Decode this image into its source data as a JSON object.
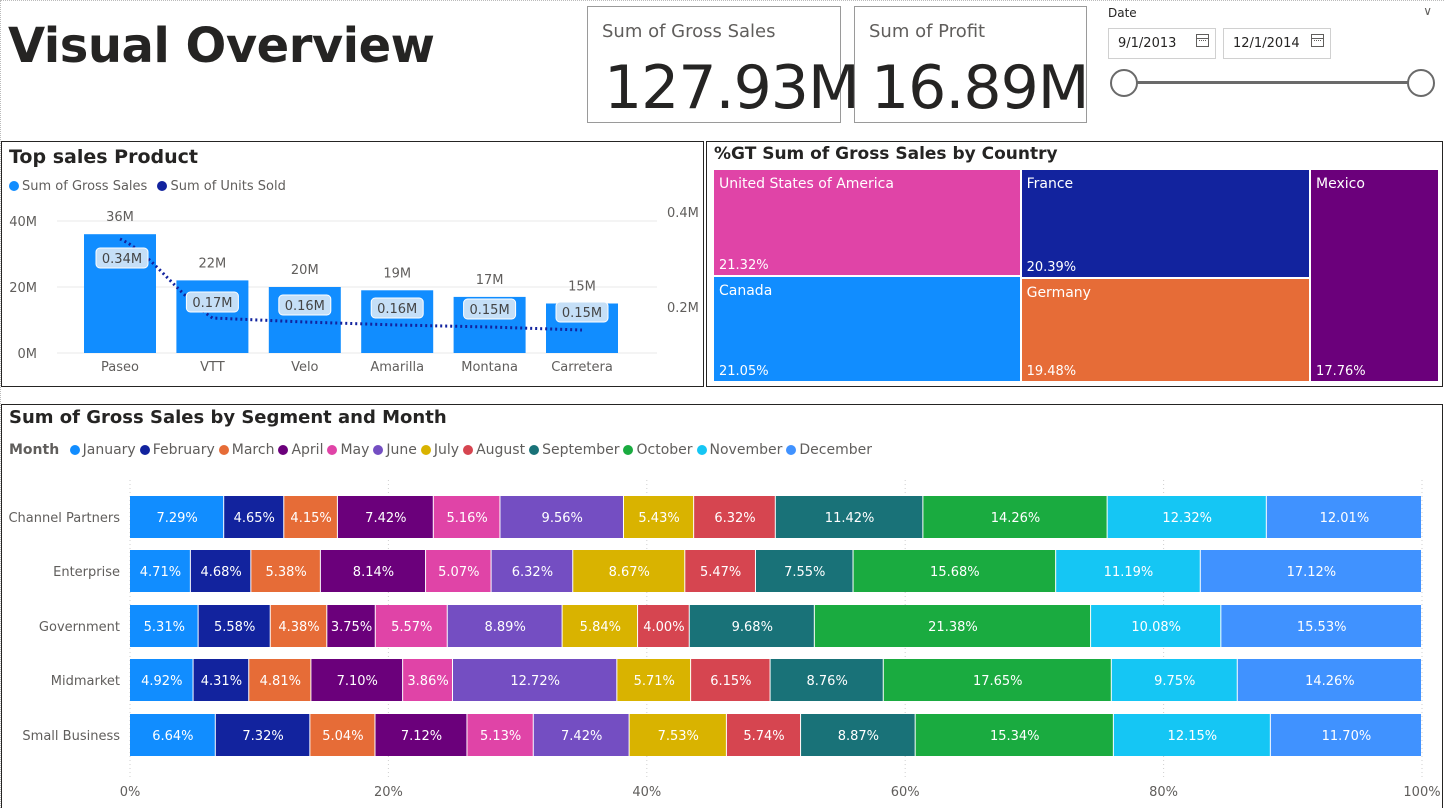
{
  "page": {
    "title": "Visual Overview"
  },
  "cards": [
    {
      "label": "Sum of Gross Sales",
      "value": "127.93M"
    },
    {
      "label": "Sum of Profit",
      "value": "16.89M"
    }
  ],
  "slicer": {
    "title": "Date",
    "start_date": "9/1/2013",
    "end_date": "12/1/2014",
    "range_start": 0,
    "range_end": 1
  },
  "colors": {
    "gross_sales": "#118DFF",
    "units_sold": "#12239E",
    "axis_text": "#605e5c",
    "gridline": "#e9e9e9"
  },
  "chart_data": [
    {
      "id": "top-sales",
      "type": "bar",
      "title": "Top sales Product",
      "legend": [
        "Sum of Gross Sales",
        "Sum of Units Sold"
      ],
      "legend_position": "top-left",
      "categories": [
        "Paseo",
        "VTT",
        "Velo",
        "Amarilla",
        "Montana",
        "Carretera"
      ],
      "series": [
        {
          "name": "Sum of Gross Sales",
          "type": "bar",
          "axis": "left",
          "values": [
            36,
            22,
            20,
            19,
            17,
            15
          ],
          "labels": [
            "36M",
            "22M",
            "20M",
            "19M",
            "17M",
            "15M"
          ],
          "color": "#118DFF"
        },
        {
          "name": "Sum of Units Sold",
          "type": "line",
          "style": "dotted",
          "axis": "right",
          "values": [
            0.34,
            0.17,
            0.16,
            0.16,
            0.15,
            0.15
          ],
          "labels": [
            "0.34M",
            "0.17M",
            "0.16M",
            "0.16M",
            "0.15M",
            "0.15M"
          ],
          "color": "#12239E"
        }
      ],
      "y_left": {
        "ticks": [
          "0M",
          "20M",
          "40M"
        ],
        "tick_values": [
          0,
          20,
          40
        ],
        "ylim": [
          0,
          44
        ]
      },
      "y_right": {
        "ticks": [
          "0.2M",
          "0.4M"
        ],
        "tick_values": [
          0.2,
          0.4
        ],
        "ylim": [
          0,
          0.44
        ]
      },
      "grid": true
    },
    {
      "id": "treemap-country",
      "type": "treemap",
      "title": "%GT Sum of Gross Sales by Country",
      "items": [
        {
          "name": "United States of America",
          "value": "21.32%",
          "pct": 21.32,
          "color": "#E044A7"
        },
        {
          "name": "Canada",
          "value": "21.05%",
          "pct": 21.05,
          "color": "#118DFF"
        },
        {
          "name": "France",
          "value": "20.39%",
          "pct": 20.39,
          "color": "#12239E"
        },
        {
          "name": "Germany",
          "value": "19.48%",
          "pct": 19.48,
          "color": "#E66C37"
        },
        {
          "name": "Mexico",
          "value": "17.76%",
          "pct": 17.76,
          "color": "#6B007B"
        }
      ]
    },
    {
      "id": "segment-month",
      "type": "bar",
      "orientation": "horizontal",
      "stacking": "100%",
      "title": "Sum of Gross Sales by Segment and Month",
      "legend_title": "Month",
      "legend_position": "top-left",
      "categories": [
        "Channel Partners",
        "Enterprise",
        "Government",
        "Midmarket",
        "Small Business"
      ],
      "x_ticks": [
        "0%",
        "20%",
        "40%",
        "60%",
        "80%",
        "100%"
      ],
      "xlim": [
        0,
        100
      ],
      "grid": true,
      "series": [
        {
          "name": "January",
          "color": "#118DFF",
          "values": [
            7.29,
            4.71,
            5.31,
            4.92,
            6.64
          ]
        },
        {
          "name": "February",
          "color": "#12239E",
          "values": [
            4.65,
            4.68,
            5.58,
            4.31,
            7.32
          ]
        },
        {
          "name": "March",
          "color": "#E66C37",
          "values": [
            4.15,
            5.38,
            4.38,
            4.81,
            5.04
          ]
        },
        {
          "name": "April",
          "color": "#6B007B",
          "values": [
            7.42,
            8.14,
            3.75,
            7.1,
            7.12
          ]
        },
        {
          "name": "May",
          "color": "#E044A7",
          "values": [
            5.16,
            5.07,
            5.57,
            3.86,
            5.13
          ]
        },
        {
          "name": "June",
          "color": "#744EC2",
          "values": [
            9.56,
            6.32,
            8.89,
            12.72,
            7.42
          ]
        },
        {
          "name": "July",
          "color": "#D9B300",
          "values": [
            5.43,
            8.67,
            5.84,
            5.71,
            7.53
          ]
        },
        {
          "name": "August",
          "color": "#D64550",
          "values": [
            6.32,
            5.47,
            4.0,
            6.15,
            5.74
          ]
        },
        {
          "name": "September",
          "color": "#197278",
          "values": [
            11.42,
            7.55,
            9.68,
            8.76,
            8.87
          ]
        },
        {
          "name": "October",
          "color": "#1AAB40",
          "values": [
            14.26,
            15.68,
            21.38,
            17.65,
            15.34
          ]
        },
        {
          "name": "November",
          "color": "#15C6F4",
          "values": [
            12.32,
            11.19,
            10.08,
            9.75,
            12.15
          ]
        },
        {
          "name": "December",
          "color": "#4092FF",
          "values": [
            12.01,
            17.12,
            15.53,
            14.26,
            11.7
          ]
        }
      ]
    }
  ]
}
